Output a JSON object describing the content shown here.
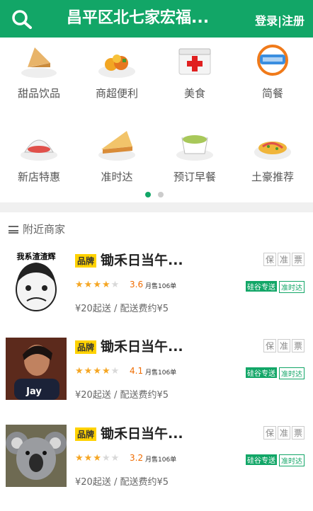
{
  "header": {
    "title": "昌平区北七家宏福...",
    "login_label": "登录|注册"
  },
  "categories": [
    {
      "label": "甜品饮品",
      "icon": "dessert-icon"
    },
    {
      "label": "商超便利",
      "icon": "supermarket-icon"
    },
    {
      "label": "美食",
      "icon": "food-icon"
    },
    {
      "label": "简餐",
      "icon": "simple-meal-icon"
    },
    {
      "label": "新店特惠",
      "icon": "new-store-icon"
    },
    {
      "label": "准时达",
      "icon": "on-time-icon"
    },
    {
      "label": "预订早餐",
      "icon": "breakfast-icon"
    },
    {
      "label": "土豪推荐",
      "icon": "recommend-icon"
    }
  ],
  "pager": {
    "pages": 2,
    "active": 1
  },
  "nearby": {
    "title": "附近商家"
  },
  "shops": [
    {
      "brand_label": "品牌",
      "name": "锄禾日当午...",
      "tags": [
        "保",
        "准",
        "票"
      ],
      "rating": 3.6,
      "rating_text": "3.6",
      "sales": "月售106单",
      "delivery_badge": "硅谷专送",
      "ontime_badge": "准时达",
      "info": "¥20起送 / 配送费约¥5",
      "avatar_text": "我系渣渣辉"
    },
    {
      "brand_label": "品牌",
      "name": "锄禾日当午...",
      "tags": [
        "保",
        "准",
        "票"
      ],
      "rating": 4.1,
      "rating_text": "4.1",
      "sales": "月售106单",
      "delivery_badge": "硅谷专送",
      "ontime_badge": "准时达",
      "info": "¥20起送 / 配送费约¥5",
      "avatar_text": "Jay"
    },
    {
      "brand_label": "品牌",
      "name": "锄禾日当午...",
      "tags": [
        "保",
        "准",
        "票"
      ],
      "rating": 3.2,
      "rating_text": "3.2",
      "sales": "月售106单",
      "delivery_badge": "硅谷专送",
      "ontime_badge": "准时达",
      "info": "¥20起送 / 配送费约¥5",
      "avatar_text": ""
    }
  ],
  "colors": {
    "brand": "#12a667",
    "star": "#f5a623",
    "rating": "#f06c00"
  }
}
